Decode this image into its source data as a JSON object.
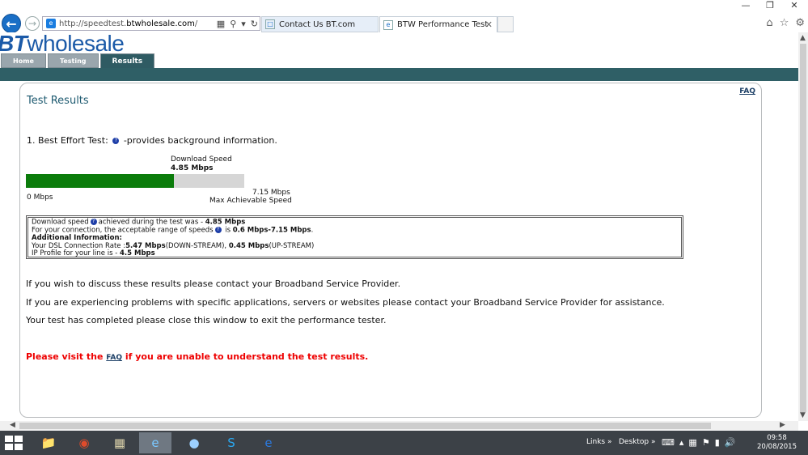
{
  "browser": {
    "url_prefix": "http://speedtest.",
    "url_domain": "btwholesale.com",
    "url_suffix": "/",
    "tabs": [
      {
        "label": "Contact Us BT.com"
      },
      {
        "label": "BTW Performance Test"
      }
    ]
  },
  "site": {
    "logo_bt": "BT",
    "logo_rest": "wholesale",
    "nav": [
      {
        "label": "Home"
      },
      {
        "label": "Testing"
      },
      {
        "label": "Results"
      }
    ],
    "active_tab": "Results"
  },
  "results": {
    "faq_label": "FAQ",
    "title": "Test Results",
    "best_effort_prefix": "1. Best Effort Test:",
    "best_effort_suffix": "-provides background information.",
    "download_label": "Download  Speed",
    "download_value": "4.85 Mbps",
    "bar": {
      "min_label": "0 Mbps",
      "max_label": "7.15 Mbps",
      "max_caption": "Max Achievable Speed",
      "value": 4.85,
      "max": 7.15
    },
    "info": {
      "line1_a": "Download speed",
      "line1_b": "achieved during the test was - ",
      "line1_val": "4.85 Mbps",
      "line2_a": "For your connection, the acceptable range of speeds",
      "line2_b": " is ",
      "line2_val": "0.6 Mbps-7.15 Mbps",
      "line2_end": ".",
      "heading": "Additional Information:",
      "line4_a": "Your DSL Connection Rate :",
      "line4_v1": "5.47 Mbps",
      "line4_b": "(DOWN-STREAM), ",
      "line4_v2": "0.45 Mbps",
      "line4_c": "(UP-STREAM)",
      "line5_a": "IP Profile for your line is - ",
      "line5_val": "4.5 Mbps"
    },
    "para1": "If you wish to discuss these results please contact your Broadband Service Provider.",
    "para2": "If you are experiencing problems with specific applications, servers or websites please contact your Broadband Service Provider for assistance.",
    "para3": "Your test has completed please close this window to exit the performance tester.",
    "red_prefix": "Please visit the ",
    "red_link": "FAQ",
    "red_suffix": " if you are unable to understand the test results."
  },
  "taskbar": {
    "links_label": "Links",
    "desktop_label": "Desktop",
    "time": "09:58",
    "date": "20/08/2015"
  }
}
